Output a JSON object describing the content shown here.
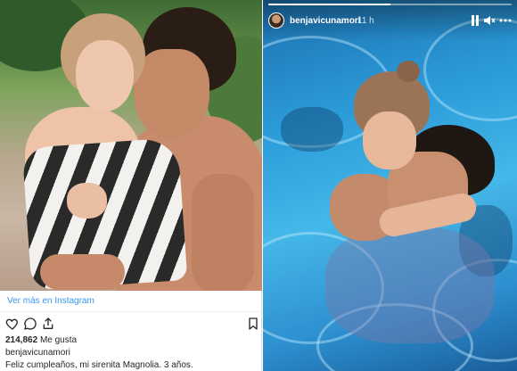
{
  "post": {
    "see_more": "Ver más en Instagram",
    "likes_count": "214,862",
    "likes_label": "Me gusta",
    "username": "benjavicunamori",
    "caption": "Feliz cumpleaños, mi sirenita Magnolia. 3 años."
  },
  "story": {
    "username": "benjavicunamori",
    "time": "11 h",
    "progress": 0.5
  },
  "icons": [
    "heart-icon",
    "comment-icon",
    "share-icon",
    "bookmark-icon",
    "pause-icon",
    "mute-icon",
    "more-icon"
  ],
  "colors": {
    "link": "#3897f0",
    "text": "#262626",
    "pool": "#2b9bd8"
  }
}
